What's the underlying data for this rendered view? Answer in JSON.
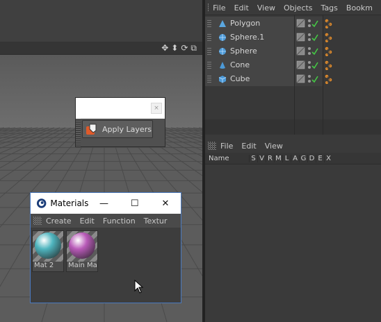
{
  "viewport": {
    "nav_icons": [
      "move-icon",
      "scale-icon",
      "rotate-icon",
      "maximize-icon"
    ]
  },
  "apply_palette": {
    "close_glyph": "×",
    "button_label": "Apply Layers",
    "button_icon": "apply-layers-icon"
  },
  "materials_window": {
    "title": "Materials",
    "controls": {
      "minimize": "—",
      "maximize": "☐",
      "close": "✕"
    },
    "menu": [
      "Create",
      "Edit",
      "Function",
      "Textur"
    ],
    "materials": [
      {
        "label": "Mat 2",
        "color": "#4fb5bf"
      },
      {
        "label": "Main Ma",
        "color": "#b85ab8"
      }
    ]
  },
  "object_manager": {
    "menu": [
      "File",
      "Edit",
      "View",
      "Objects",
      "Tags",
      "Bookm"
    ],
    "objects": [
      {
        "name": "Polygon",
        "icon": "polygon-icon"
      },
      {
        "name": "Sphere.1",
        "icon": "sphere-icon"
      },
      {
        "name": "Sphere",
        "icon": "sphere-icon"
      },
      {
        "name": "Cone",
        "icon": "cone-icon"
      },
      {
        "name": "Cube",
        "icon": "cube-icon"
      }
    ]
  },
  "layer_manager": {
    "menu": [
      "File",
      "Edit",
      "View"
    ],
    "header": {
      "name": "Name",
      "columns": [
        "S",
        "V",
        "R",
        "M",
        "L",
        "A",
        "G",
        "D",
        "E",
        "X"
      ]
    }
  },
  "colors": {
    "window_border": "#4a7ac0",
    "check": "#45c845",
    "tag": "#e08a2a"
  }
}
